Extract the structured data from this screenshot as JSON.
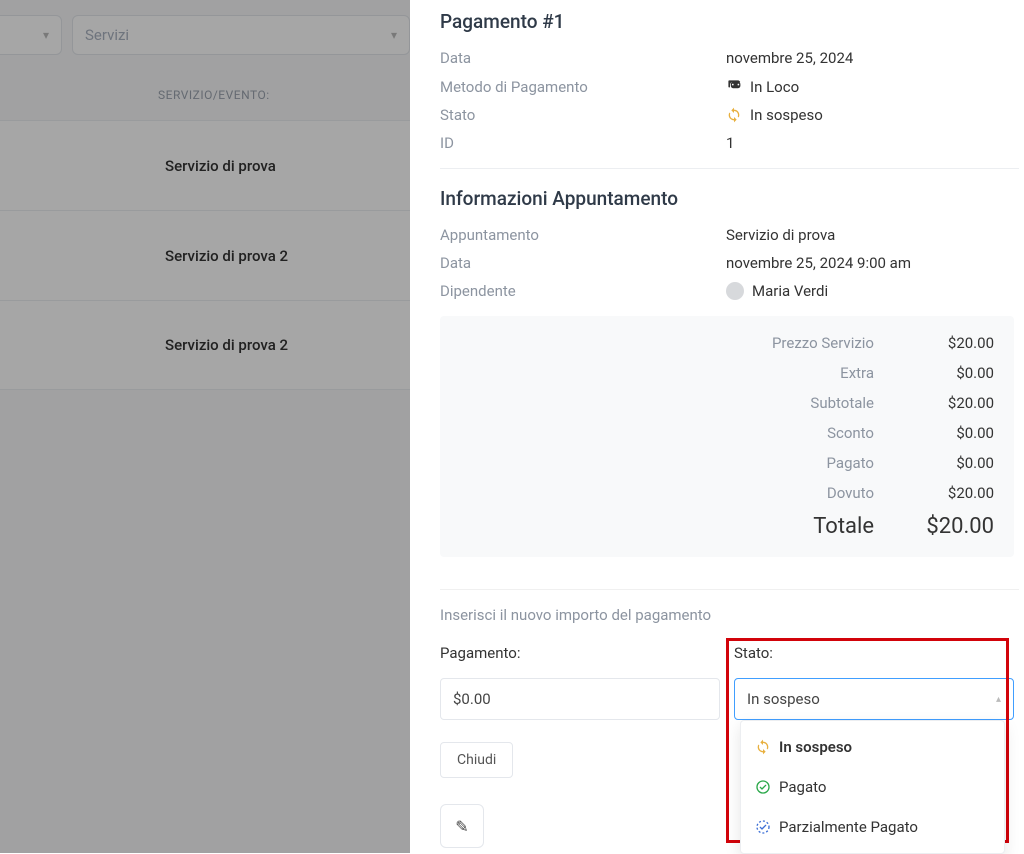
{
  "filters": {
    "services_placeholder": "Servizi"
  },
  "table_header": "SERVIZIO/EVENTO:",
  "services": [
    "Servizio di prova",
    "Servizio di prova 2",
    "Servizio di prova 2"
  ],
  "panel": {
    "title": "Pagamento #1",
    "info": {
      "date_label": "Data",
      "date_value": "novembre 25, 2024",
      "method_label": "Metodo di Pagamento",
      "method_value": "In Loco",
      "status_label": "Stato",
      "status_value": "In sospeso",
      "id_label": "ID",
      "id_value": "1"
    },
    "appointment_title": "Informazioni Appuntamento",
    "appointment": {
      "label": "Appuntamento",
      "value": "Servizio di prova",
      "date_label": "Data",
      "date_value": "novembre 25, 2024 9:00 am",
      "employee_label": "Dipendente",
      "employee_value": "Maria Verdi"
    },
    "price": {
      "service_label": "Prezzo Servizio",
      "service_value": "$20.00",
      "extra_label": "Extra",
      "extra_value": "$0.00",
      "subtotal_label": "Subtotale",
      "subtotal_value": "$20.00",
      "discount_label": "Sconto",
      "discount_value": "$0.00",
      "paid_label": "Pagato",
      "paid_value": "$0.00",
      "due_label": "Dovuto",
      "due_value": "$20.00",
      "total_label": "Totale",
      "total_value": "$20.00"
    },
    "entry": {
      "intro": "Inserisci il nuovo importo del pagamento",
      "payment_label": "Pagamento:",
      "payment_value": "$0.00",
      "state_label": "Stato:",
      "state_value": "In sospeso",
      "options": [
        "In sospeso",
        "Pagato",
        "Parzialmente Pagato"
      ],
      "close": "Chiudi"
    }
  }
}
